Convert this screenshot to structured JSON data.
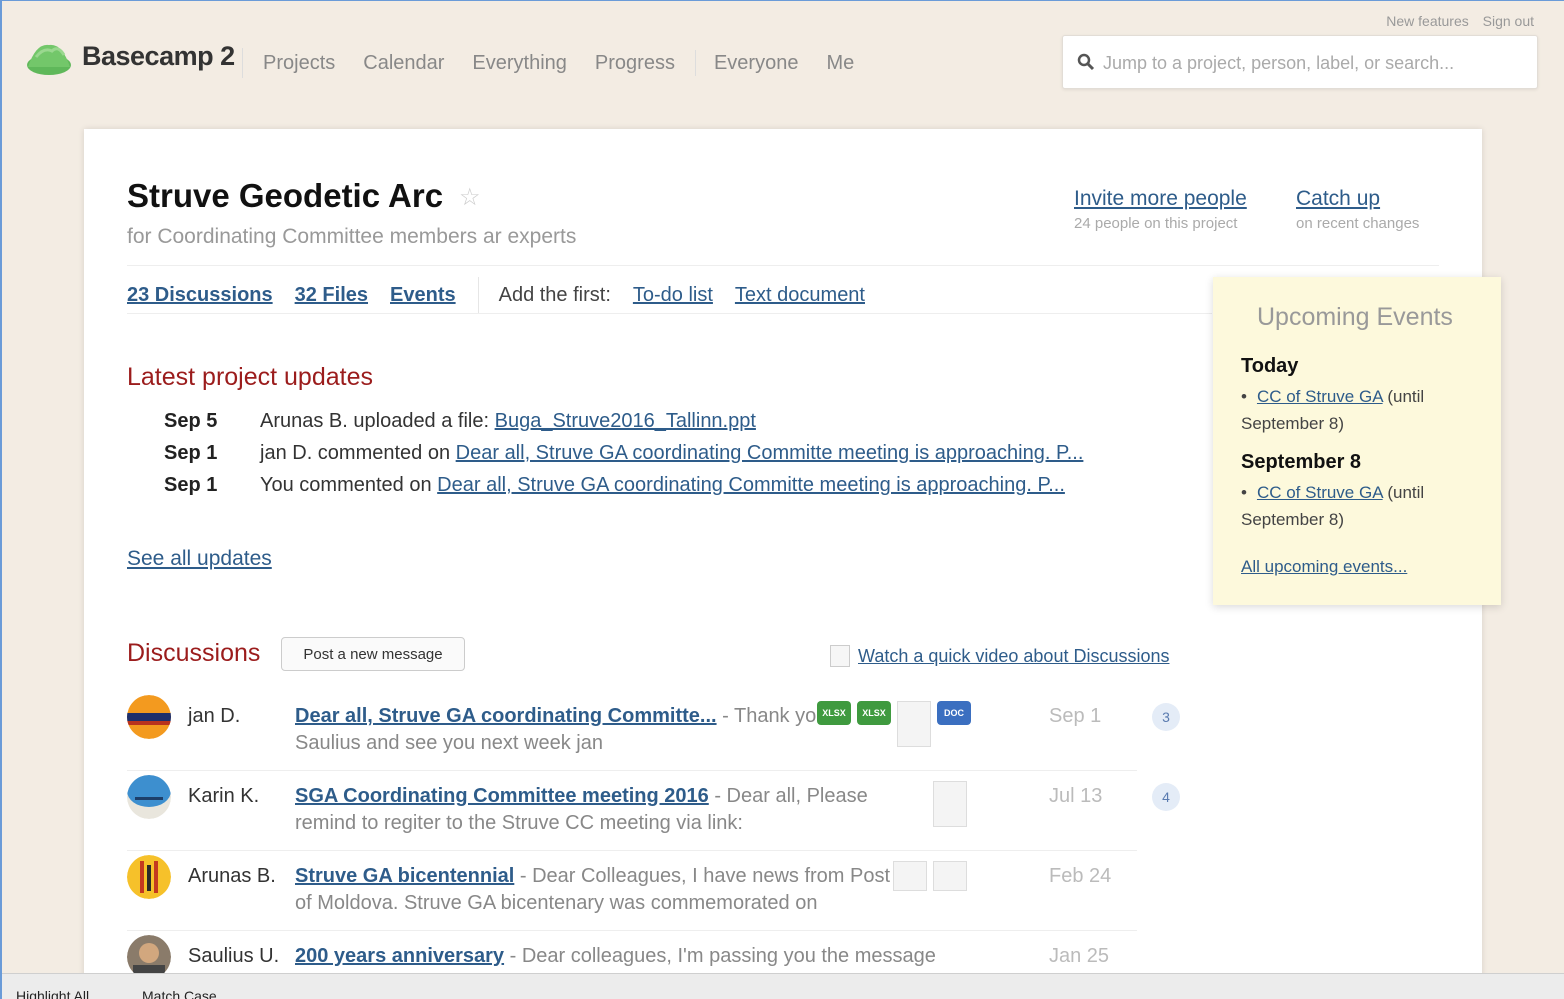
{
  "app": {
    "name": "Basecamp 2",
    "nav": [
      "Projects",
      "Calendar",
      "Everything",
      "Progress",
      "Everyone",
      "Me"
    ],
    "top_links": [
      "New features",
      "Sign out"
    ],
    "search_placeholder": "Jump to a project, person, label, or search...",
    "accent_color": "#2e5c8a"
  },
  "project": {
    "title": "Struve Geodetic Arc",
    "subtitle": "for Coordinating Committee members ar experts",
    "invite": {
      "label": "Invite more people",
      "sub": "24 people on this project"
    },
    "catchup": {
      "label": "Catch up",
      "sub": "on recent changes"
    },
    "tabs": [
      "23 Discussions",
      "32 Files",
      "Events"
    ],
    "add_first_label": "Add the first:",
    "add_first_links": [
      "To-do list",
      "Text document"
    ]
  },
  "updates": {
    "title": "Latest project updates",
    "items": [
      {
        "date": "Sep 5",
        "prefix": "Arunas B. uploaded a file: ",
        "link": "Buga_Struve2016_Tallinn.ppt"
      },
      {
        "date": "Sep 1",
        "prefix": "jan D. commented on ",
        "link": "Dear all, Struve GA coordinating Committe meeting is approaching. P..."
      },
      {
        "date": "Sep 1",
        "prefix": "You commented on ",
        "link": "Dear all, Struve GA coordinating Committe meeting is approaching. P..."
      }
    ],
    "see_all": "See all updates"
  },
  "discussions": {
    "title": "Discussions",
    "post_button": "Post a new message",
    "video_link": "Watch a quick video about Discussions",
    "items": [
      {
        "author": "jan D.",
        "title": "Dear all, Struve GA coordinating Committe...",
        "excerpt": " - Thank you Saulius and see you next week jan",
        "date": "Sep 1",
        "count": "3"
      },
      {
        "author": "Karin K.",
        "title": "SGA Coordinating Committee meeting 2016",
        "excerpt": " - Dear all, Please remind to regiter to the Struve CC meeting via link:",
        "date": "Jul 13",
        "count": "4"
      },
      {
        "author": "Arunas B.",
        "title": "Struve GA bicentennial",
        "excerpt": " - Dear Colleagues, I have news from Post of Moldova. Struve GA bicentenary was commemorated on",
        "date": "Feb 24",
        "count": ""
      },
      {
        "author": "Saulius U.",
        "title": "200 years anniversary",
        "excerpt": " - Dear colleagues, I'm passing you the message",
        "date": "Jan 25",
        "count": ""
      }
    ],
    "attachment_labels": {
      "xls": "XLSX",
      "doc": "DOC"
    }
  },
  "events": {
    "title": "Upcoming Events",
    "groups": [
      {
        "day": "Today",
        "link": "CC of Struve GA",
        "rest": " (until September 8)"
      },
      {
        "day": "September 8",
        "link": "CC of Struve GA",
        "rest": " (until September 8)"
      }
    ],
    "all_link": "All upcoming events..."
  },
  "findbar": {
    "highlight": "Highlight All",
    "match_case": "Match Case"
  }
}
